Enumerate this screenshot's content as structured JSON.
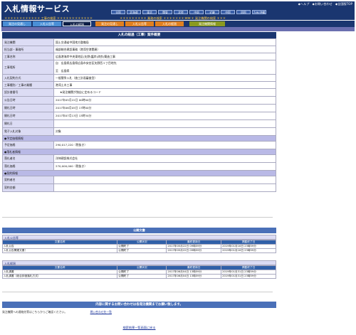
{
  "header": {
    "title": "入札情報サービス",
    "links": [
      "◆ヘルプ",
      "◆お問い合わせ",
      "◆全国版TOP"
    ],
    "regions": [
      "全国",
      "北海道",
      "東北",
      "関東",
      "北陸",
      "中部",
      "近畿",
      "中国",
      "四国",
      "九州/沖縄"
    ],
    "sections": [
      "＊＊＊＊＊＊＊＊＊＊＊＊ 工事の検索 ＊＊＊＊＊＊＊＊＊＊＊＊",
      "＊＊＊＊＊＊＊＊＊ 業務の検索 ＊＊＊＊＊＊＊＊＊",
      "＊＊＊ 発注機関の検索 ＊＊＊"
    ]
  },
  "tabs": [
    "発注の見通し",
    "入札公告等",
    "入札の経過",
    "発注の見通し",
    "入札公告等",
    "入札の経過",
    "発注機関情報"
  ],
  "detail": {
    "title": "入札の経過（工事）案件概要",
    "rows": [
      {
        "label": "発注機関",
        "value": "国土交通省中国地方整備局"
      },
      {
        "label": "担当部・事務所",
        "value": "福部総合建設事務（港湾空港関連）"
      },
      {
        "label": "工事名称",
        "value": "広島港海岸中央東地区(矢野)護岸(改良)築造工事"
      },
      {
        "label": "工事場所",
        "value": "自　広島県広島県広島市安芸区矢野西１丁目地先",
        "value2": "至　広島県"
      },
      {
        "label": "入札契約方式",
        "value": "一般競争入札（施工計画審査型）"
      },
      {
        "label": "工事種別／工事の業種",
        "value": "港湾土木工事"
      },
      {
        "label": "設計書番号",
        "value": "★発注機関が独自に定めるコード"
      },
      {
        "label": "公告日時",
        "value": "2017年05月22日 00時00分"
      },
      {
        "label": "開札日時",
        "value": "2017年06月05日 17時00分"
      },
      {
        "label": "開札日時",
        "value": "2017年07月13日 13時34分"
      },
      {
        "label": "開札日",
        "value": ""
      },
      {
        "label": "電子入札対象",
        "value": "対象"
      }
    ],
    "section_estimated": "●予定価格情報",
    "estimated": {
      "label": "予定価格",
      "value": "290,017,220（税抜き）"
    },
    "section_winner": "●落札者情報",
    "winner": [
      {
        "label": "落札者名",
        "value": "洋伸建設株式会社"
      },
      {
        "label": "落札価格",
        "value": "270,000,000（税抜き）"
      }
    ],
    "section_contract": "●契約情報",
    "contract": [
      {
        "label": "契約者名",
        "value": ""
      },
      {
        "label": "契約金額",
        "value": ""
      }
    ]
  },
  "public_docs": {
    "title": "公開文書",
    "groups": [
      {
        "title": "入札公告等",
        "columns": [
          "文書名称",
          "公開状況",
          "最終更新日",
          "掲載終了日"
        ],
        "rows": [
          [
            "入札公告",
            "公開終了",
            "2017年05月22日 09時59分",
            "2019年01月16日 23時59分"
          ],
          [
            "入札公告関連文書！",
            "公開終了",
            "2017年05月22日 09時59分",
            "2019年01月16日 23時59分"
          ]
        ]
      },
      {
        "title": "入札経過",
        "columns": [
          "文書名称",
          "公開状況",
          "最終更新日",
          "掲載終了日"
        ],
        "rows": [
          [
            "入札調書",
            "公開終了",
            "2017年06月04日 13時59分",
            "2019年01月31日 23時59分"
          ],
          [
            "入札調書（総合評価落札方式）",
            "公開終了",
            "2017年06月04日 13時59分",
            "2019年01月31日 23時59分"
          ]
        ]
      }
    ]
  },
  "contact": {
    "title": "内容に関するお問い合わせは各発注機関までお願い致します。",
    "note": "発注機関への連絡先等はこちらからご確認ください。",
    "link": "問い合わせ先一覧",
    "back": "検索結果一覧画面に戻る"
  },
  "colors": {
    "navy": "#1a3670",
    "label_bg": "#dcdcf4",
    "section_bg": "#b9b9e6",
    "bar_blue": "#4a70b8"
  }
}
